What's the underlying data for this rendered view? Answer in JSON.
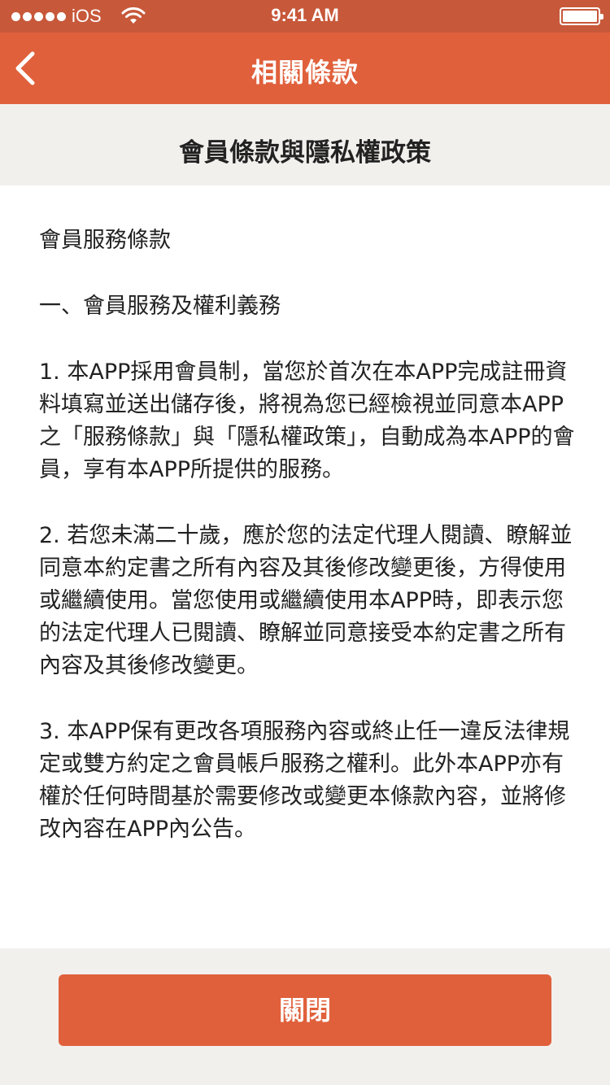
{
  "status_bar": {
    "carrier": "iOS",
    "time": "9:41 AM"
  },
  "nav": {
    "title": "相關條款",
    "back_icon": "chevron-left-icon"
  },
  "section": {
    "title": "會員條款與隱私權政策"
  },
  "body": {
    "heading": "會員服務條款",
    "subheading": "一、會員服務及權利義務",
    "paragraphs": [
      "1. 本APP採用會員制，當您於首次在本APP完成註冊資料填寫並送出儲存後，將視為您已經檢視並同意本APP之「服務條款」與「隱私權政策」，自動成為本APP的會員，享有本APP所提供的服務。",
      "2. 若您未滿二十歲，應於您的法定代理人閱讀、瞭解並同意本約定書之所有內容及其後修改變更後，方得使用或繼續使用。當您使用或繼續使用本APP時，即表示您的法定代理人已閱讀、瞭解並同意接受本約定書之所有內容及其後修改變更。",
      "3. 本APP保有更改各項服務內容或終止任一違反法律規定或雙方約定之會員帳戶服務之權利。此外本APP亦有權於任何時間基於需要修改或變更本條款內容，並將修改內容在APP內公告。"
    ]
  },
  "footer": {
    "close_label": "關閉"
  },
  "colors": {
    "accent": "#e0603b",
    "status_bar": "#c7583a",
    "panel": "#f2f0ed"
  }
}
